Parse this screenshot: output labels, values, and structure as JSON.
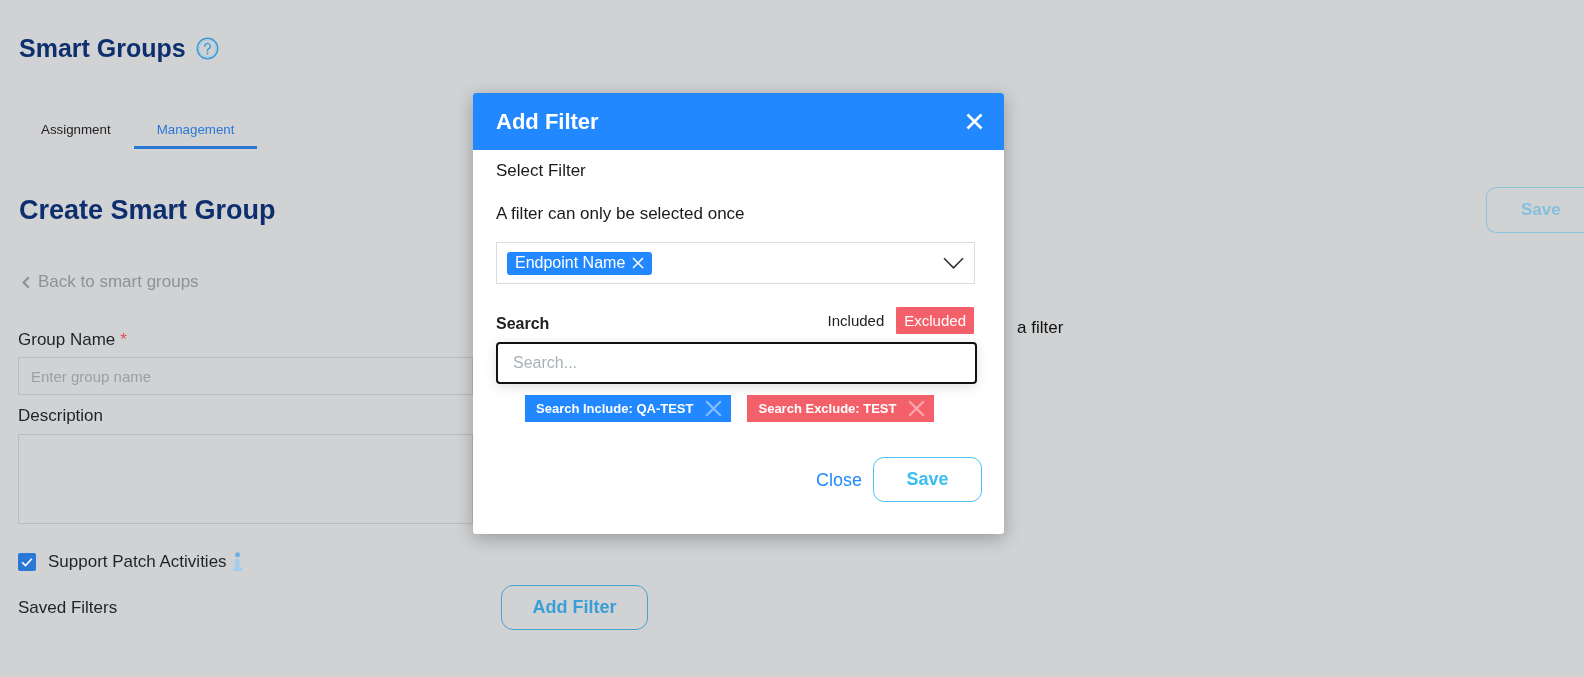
{
  "page": {
    "title": "Smart Groups",
    "tabs": [
      {
        "label": "Assignment",
        "selected": false
      },
      {
        "label": "Management",
        "selected": true
      }
    ],
    "heading": "Create Smart Group",
    "save_button": "Save",
    "back_link": "Back to smart groups",
    "form": {
      "group_name": {
        "label": "Group Name",
        "required_mark": "*",
        "placeholder": "Enter group name"
      },
      "description": {
        "label": "Description"
      },
      "support_patch": {
        "label": "Support Patch Activities",
        "checked": true
      },
      "saved_filters": {
        "label": "Saved Filters",
        "add_button": "Add Filter"
      }
    },
    "side_text": "a filter"
  },
  "dialog": {
    "title": "Add Filter",
    "select_label": "Select Filter",
    "hint": "A filter can only be selected once",
    "selected_filters": [
      {
        "label": "Endpoint Name"
      }
    ],
    "search": {
      "label": "Search",
      "placeholder": "Search..."
    },
    "mode_toggle": [
      {
        "label": "Included",
        "selected": false
      },
      {
        "label": "Excluded",
        "selected": true
      }
    ],
    "search_chips": [
      {
        "label": "Search Include: QA-TEST",
        "color": "#2288ff"
      },
      {
        "label": "Search Exclude: TEST",
        "color": "#f4606a"
      }
    ],
    "close_link": "Close",
    "save_button": "Save"
  }
}
